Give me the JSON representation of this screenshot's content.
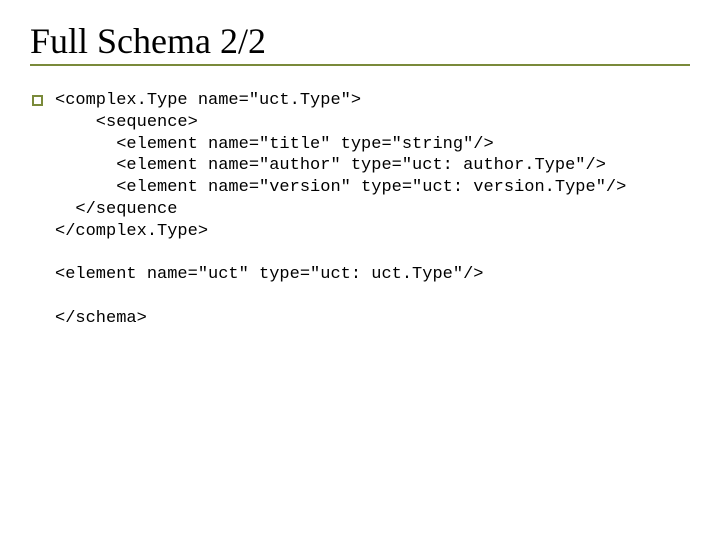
{
  "title": "Full Schema 2/2",
  "code": {
    "l1": "<complex.Type name=\"uct.Type\">",
    "l2": "    <sequence>",
    "l3": "      <element name=\"title\" type=\"string\"/>",
    "l4": "      <element name=\"author\" type=\"uct: author.Type\"/>",
    "l5": "      <element name=\"version\" type=\"uct: version.Type\"/>",
    "l6": "  </sequence",
    "l7": "</complex.Type>",
    "l8": "",
    "l9": "<element name=\"uct\" type=\"uct: uct.Type\"/>",
    "l10": "",
    "l11": "</schema>"
  }
}
